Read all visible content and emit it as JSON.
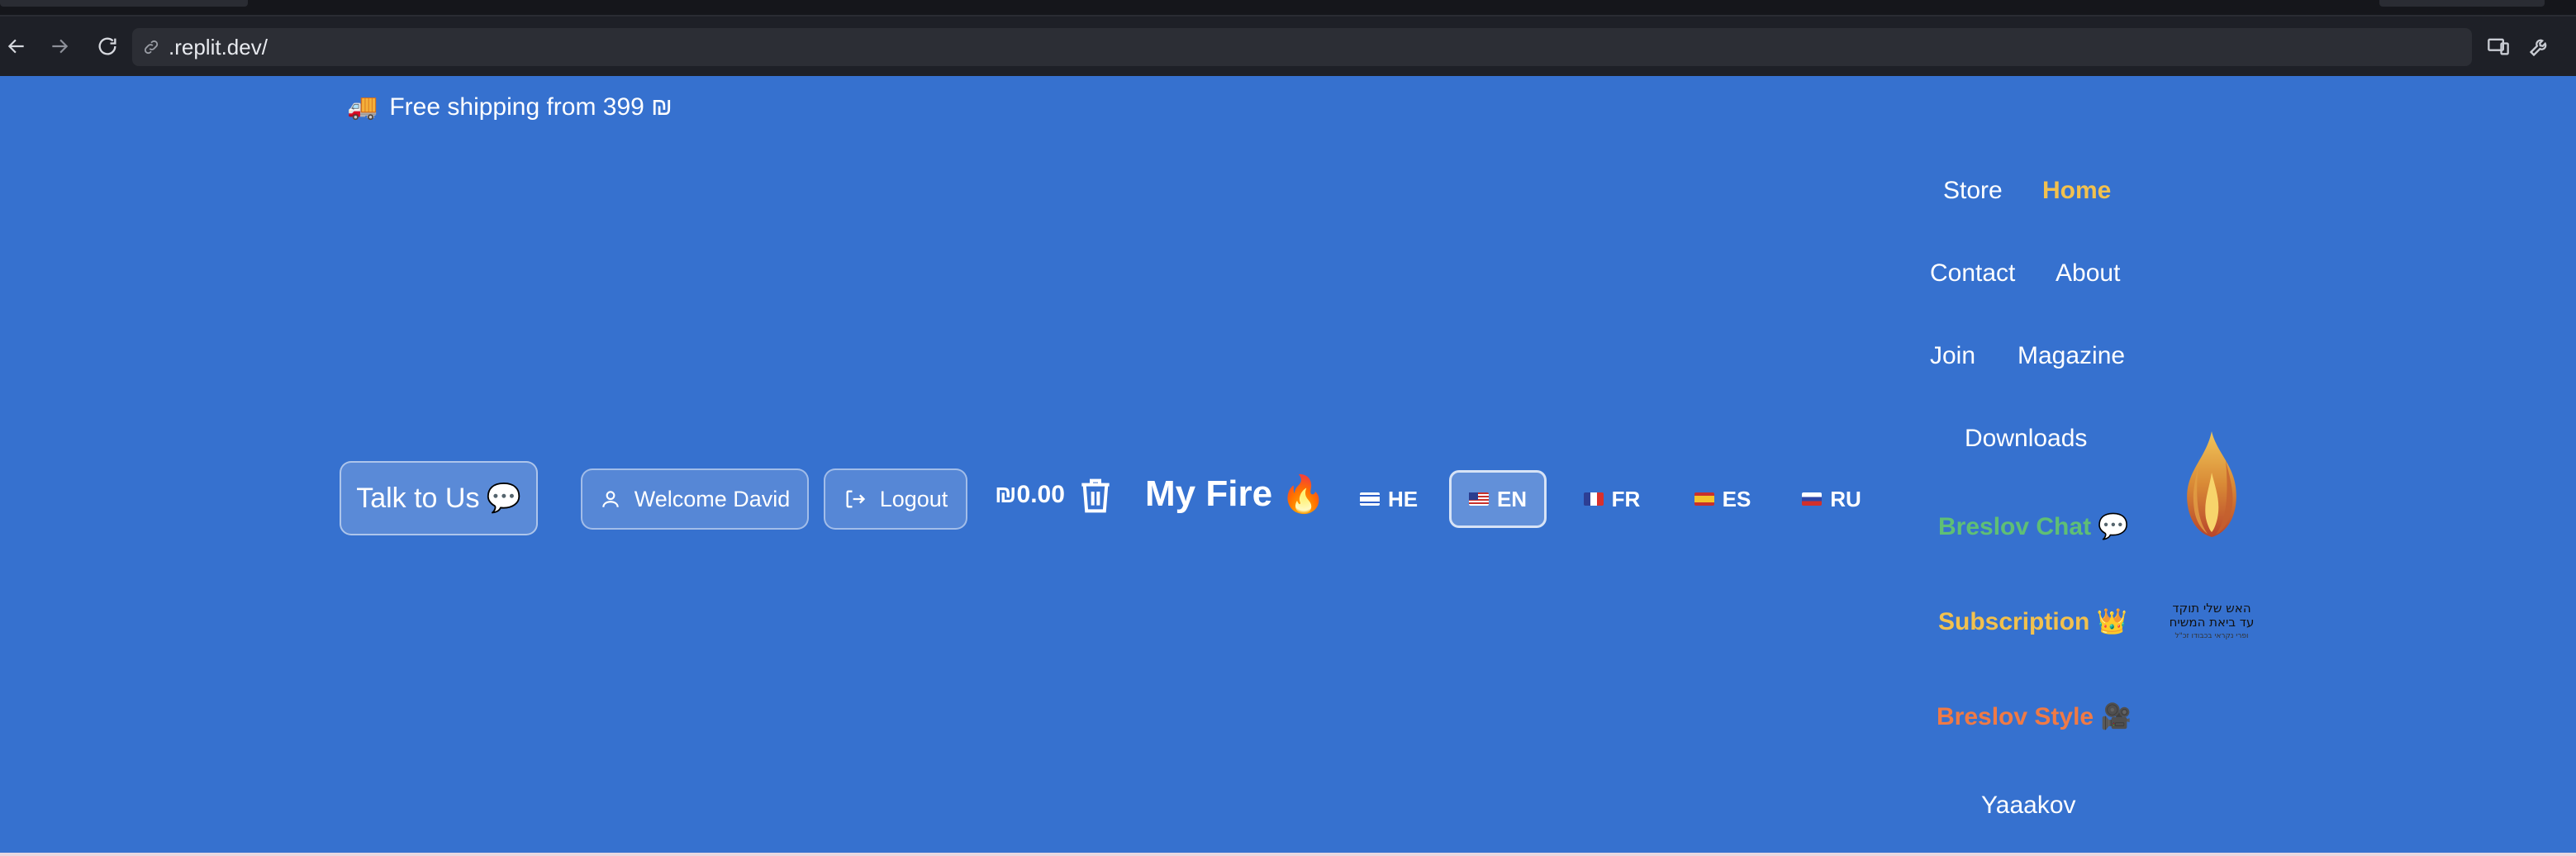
{
  "browser": {
    "url": ".replit.dev/"
  },
  "header": {
    "shipping_icon": "truck-emoji",
    "shipping_text": "Free shipping from 399 ₪"
  },
  "toolbar": {
    "talk_label": "Talk to Us",
    "talk_icon": "speech-bubble-emoji",
    "welcome_label": "Welcome David",
    "logout_label": "Logout",
    "cart_total": "₪0.00",
    "myfire_label": "My Fire",
    "myfire_icon": "fire-emoji"
  },
  "languages": [
    {
      "code": "HE",
      "flag": "israel-flag",
      "active": false
    },
    {
      "code": "EN",
      "flag": "usa-flag",
      "active": true
    },
    {
      "code": "FR",
      "flag": "france-flag",
      "active": false
    },
    {
      "code": "ES",
      "flag": "spain-flag",
      "active": false
    },
    {
      "code": "RU",
      "flag": "russia-flag",
      "active": false
    }
  ],
  "nav": {
    "store": "Store",
    "home": "Home",
    "contact": "Contact",
    "about": "About",
    "join": "Join",
    "magazine": "Magazine",
    "downloads": "Downloads",
    "breslov_chat": "Breslov Chat",
    "subscription": "Subscription",
    "breslov_style": "Breslov Style",
    "yaaakov": "Yaaakov"
  },
  "logo": {
    "line1": "האש שלי תוקד",
    "line2": "עד ביאת המשיח",
    "line3": "ופרי נקראי בכבודו זכ\"ל"
  },
  "colors": {
    "page_bg": "#3671cf",
    "home_accent": "#f2c14e",
    "breslov_chat": "#5fbf75",
    "subscription": "#f2c14e",
    "breslov_style": "#f07a45"
  }
}
